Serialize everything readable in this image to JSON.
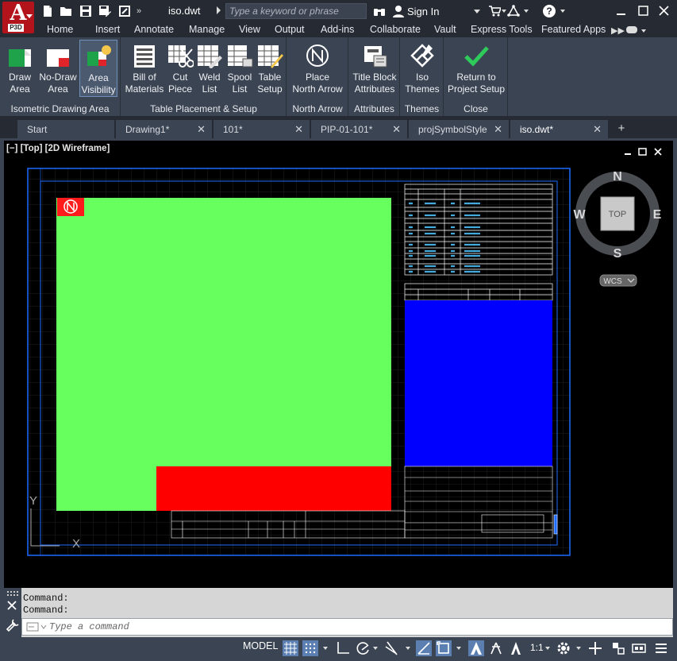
{
  "app": {
    "logo_letter": "A",
    "logo_version": "P3D",
    "doc_title": "iso.dwt"
  },
  "search": {
    "placeholder": "Type a keyword or phrase"
  },
  "account": {
    "sign_in": "Sign In"
  },
  "help": {
    "label": "?"
  },
  "ribbon_tabs": [
    "Home",
    "Insert",
    "Annotate",
    "Manage",
    "View",
    "Output",
    "Add-ins",
    "Collaborate",
    "Vault",
    "Express Tools",
    "Featured Apps"
  ],
  "ribbon_panels": [
    {
      "title": "Isometric Drawing Area",
      "buttons": [
        {
          "label": "Draw\nArea",
          "icon": "draw-area-icon"
        },
        {
          "label": "No-Draw\nArea",
          "icon": "no-draw-area-icon"
        },
        {
          "label": "Area\nVisibility",
          "icon": "area-visibility-icon",
          "active": true
        }
      ]
    },
    {
      "title": "Table Placement & Setup",
      "buttons": [
        {
          "label": "Bill of\nMaterials",
          "icon": "bill-of-materials-icon"
        },
        {
          "label": "Cut\nPiece",
          "icon": "cut-piece-icon"
        },
        {
          "label": "Weld\nList",
          "icon": "weld-list-icon"
        },
        {
          "label": "Spool\nList",
          "icon": "spool-list-icon"
        },
        {
          "label": "Table\nSetup",
          "icon": "table-setup-icon"
        }
      ]
    },
    {
      "title": "North Arrow",
      "buttons": [
        {
          "label": "Place\nNorth Arrow",
          "icon": "north-arrow-icon"
        }
      ]
    },
    {
      "title": "Attributes",
      "buttons": [
        {
          "label": "Title Block\nAttributes",
          "icon": "title-block-icon"
        }
      ]
    },
    {
      "title": "Themes",
      "buttons": [
        {
          "label": "Iso\nThemes",
          "icon": "iso-themes-icon"
        }
      ]
    },
    {
      "title": "Close",
      "buttons": [
        {
          "label": "Return to\nProject Setup",
          "icon": "checkmark-icon"
        }
      ]
    }
  ],
  "doc_tabs": [
    {
      "label": "Start",
      "closable": false
    },
    {
      "label": "Drawing1*",
      "closable": true
    },
    {
      "label": "101*",
      "closable": true
    },
    {
      "label": "PIP-01-101*",
      "closable": true
    },
    {
      "label": "projSymbolStyle",
      "closable": true
    },
    {
      "label": "iso.dwt*",
      "closable": true,
      "active": true
    }
  ],
  "viewport": {
    "label": "[−] [Top] [2D Wireframe]"
  },
  "viewcube": {
    "north": "N",
    "south": "S",
    "east": "E",
    "west": "W",
    "face": "TOP",
    "ucs": "WCS"
  },
  "ucs_icon": {
    "x": "X",
    "y": "Y"
  },
  "colors": {
    "draw_area": "#66ff5e",
    "no_draw_area": "#ff0000",
    "table_area": "#0000ff",
    "frame": "#1e6bff"
  },
  "command": {
    "history": [
      "Command:",
      "Command:"
    ],
    "placeholder": "Type a command"
  },
  "status": {
    "model": "MODEL",
    "scale": "1:1"
  }
}
